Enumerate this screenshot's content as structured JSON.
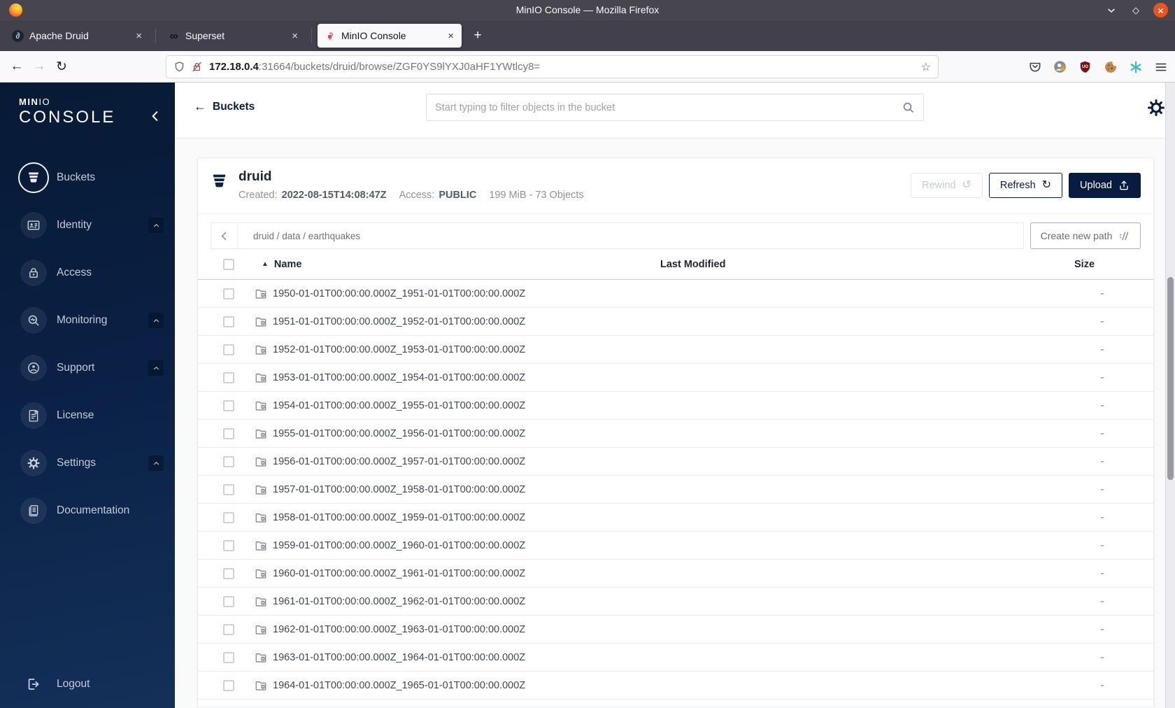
{
  "colors": {
    "brand_navy": "#081C42",
    "titlebar": "#47464f",
    "close_button": "#e95420",
    "disabled_text": "#c6ccd2"
  },
  "titlebar": {
    "title": "MinIO Console — Mozilla Firefox"
  },
  "tabs": [
    {
      "label": "Apache Druid",
      "active": false
    },
    {
      "label": "Superset",
      "active": false
    },
    {
      "label": "MinIO Console",
      "active": true
    }
  ],
  "navbar": {
    "url_domain": "172.18.0.4",
    "url_rest": ":31664/buckets/druid/browse/ZGF0YS9lYXJ0aHF1YWtlcy8="
  },
  "sidebar": {
    "logo_strong": "MIN",
    "logo_light": "IO",
    "logo_sub": "CONSOLE",
    "items": [
      {
        "label": "Buckets"
      },
      {
        "label": "Identity"
      },
      {
        "label": "Access"
      },
      {
        "label": "Monitoring"
      },
      {
        "label": "Support"
      },
      {
        "label": "License"
      },
      {
        "label": "Settings"
      },
      {
        "label": "Documentation"
      }
    ],
    "logout_label": "Logout"
  },
  "header": {
    "back_label": "Buckets",
    "search_placeholder": "Start typing to filter objects in the bucket"
  },
  "bucket": {
    "name": "druid",
    "created_label": "Created:",
    "created_value": "2022-08-15T14:08:47Z",
    "access_label": "Access:",
    "access_value": "PUBLIC",
    "usage": "199 MiB - 73 Objects",
    "rewind_label": "Rewind",
    "refresh_label": "Refresh",
    "upload_label": "Upload"
  },
  "pathbar": {
    "breadcrumb": "druid / data / earthquakes",
    "create_label": "Create new path"
  },
  "table": {
    "name_header": "Name",
    "modified_header": "Last Modified",
    "size_header": "Size",
    "size_placeholder": "-",
    "rows": [
      "1950-01-01T00:00:00.000Z_1951-01-01T00:00:00.000Z",
      "1951-01-01T00:00:00.000Z_1952-01-01T00:00:00.000Z",
      "1952-01-01T00:00:00.000Z_1953-01-01T00:00:00.000Z",
      "1953-01-01T00:00:00.000Z_1954-01-01T00:00:00.000Z",
      "1954-01-01T00:00:00.000Z_1955-01-01T00:00:00.000Z",
      "1955-01-01T00:00:00.000Z_1956-01-01T00:00:00.000Z",
      "1956-01-01T00:00:00.000Z_1957-01-01T00:00:00.000Z",
      "1957-01-01T00:00:00.000Z_1958-01-01T00:00:00.000Z",
      "1958-01-01T00:00:00.000Z_1959-01-01T00:00:00.000Z",
      "1959-01-01T00:00:00.000Z_1960-01-01T00:00:00.000Z",
      "1960-01-01T00:00:00.000Z_1961-01-01T00:00:00.000Z",
      "1961-01-01T00:00:00.000Z_1962-01-01T00:00:00.000Z",
      "1962-01-01T00:00:00.000Z_1963-01-01T00:00:00.000Z",
      "1963-01-01T00:00:00.000Z_1964-01-01T00:00:00.000Z",
      "1964-01-01T00:00:00.000Z_1965-01-01T00:00:00.000Z"
    ]
  }
}
